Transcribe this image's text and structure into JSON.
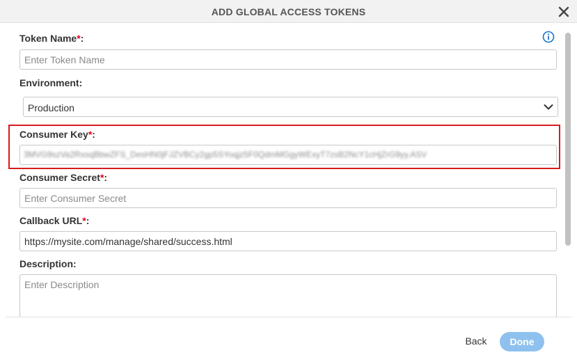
{
  "dialog": {
    "title": "ADD GLOBAL ACCESS TOKENS"
  },
  "form": {
    "token_name": {
      "label": "Token Name",
      "required_mark": "*",
      "suffix": ":",
      "placeholder": "Enter Token Name",
      "value": ""
    },
    "environment": {
      "label": "Environment:",
      "value": "Production"
    },
    "consumer_key": {
      "label": "Consumer Key",
      "required_mark": "*",
      "suffix": ":",
      "value": "3MVG9szVa2RxsqBbwZFS_DesHN0jFJZVBCy2gp5SYoqjz5F0QdmMGgyWExyT7zsB2NcY1cHjZrG9yy.ASV"
    },
    "consumer_secret": {
      "label": "Consumer Secret",
      "required_mark": "*",
      "suffix": ":",
      "placeholder": "Enter Consumer Secret",
      "value": ""
    },
    "callback_url": {
      "label": "Callback URL",
      "required_mark": "*",
      "suffix": ":",
      "value": "https://mysite.com/manage/shared/success.html"
    },
    "description": {
      "label": "Description:",
      "placeholder": "Enter Description",
      "value": ""
    }
  },
  "footer": {
    "back_label": "Back",
    "done_label": "Done"
  },
  "colors": {
    "required": "#e0001b",
    "highlight": "#d61c1c",
    "primary_disabled": "#8ec1ee",
    "info": "#1a73c9"
  },
  "icons": {
    "close": "close-icon",
    "info": "info-icon",
    "dropdown": "chevron-down-icon"
  }
}
